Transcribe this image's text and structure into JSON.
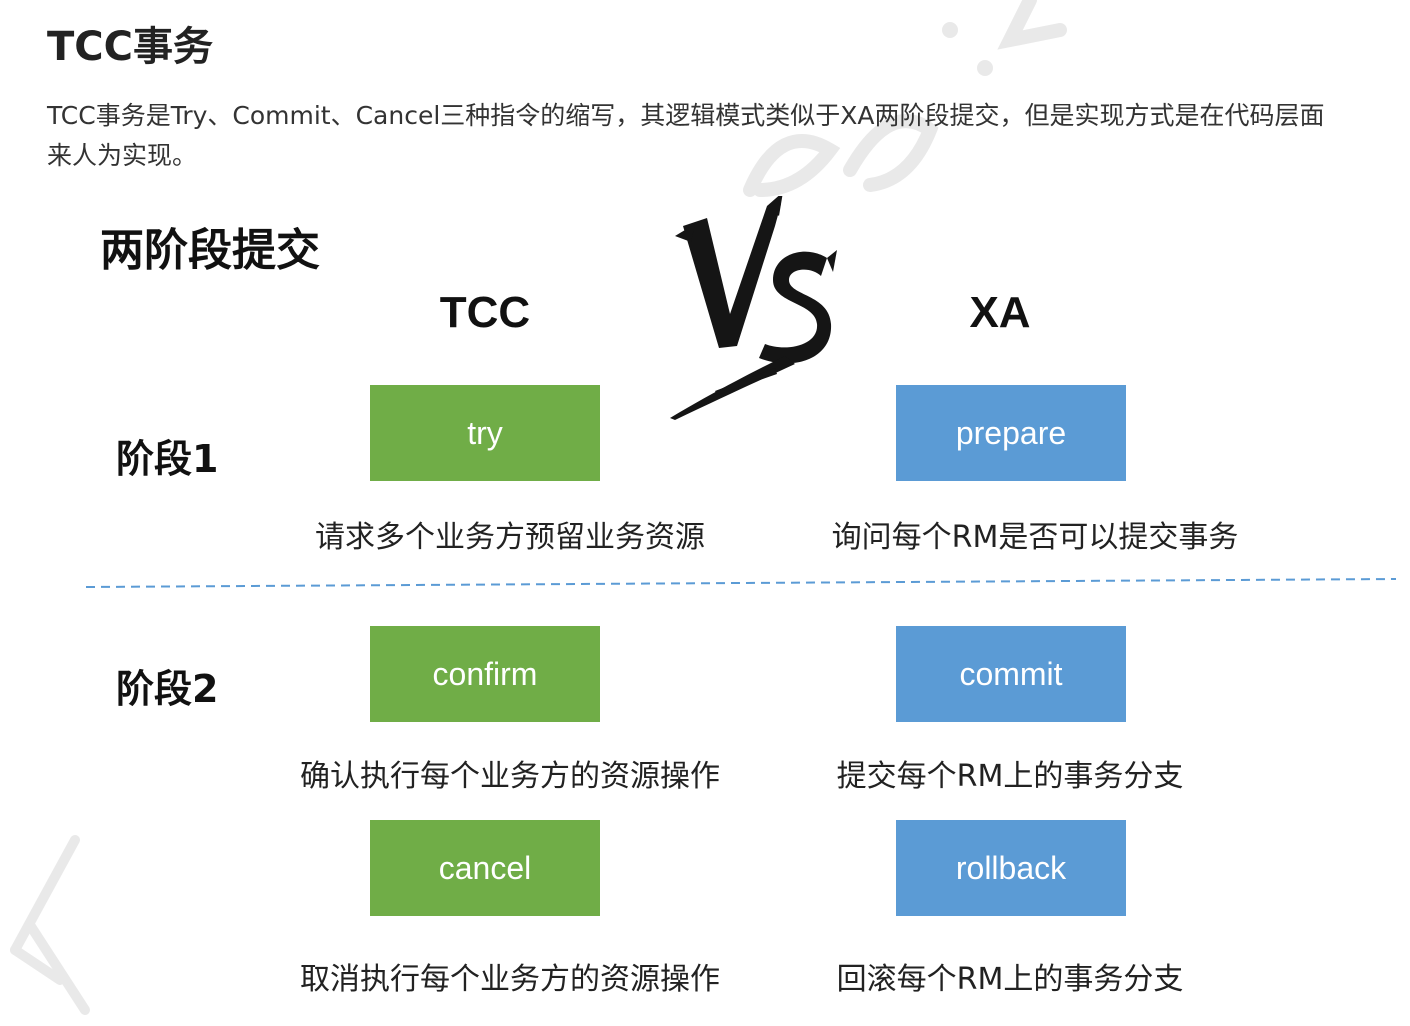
{
  "heading": "TCC事务",
  "paragraph": {
    "line1": "TCC事务是Try、Commit、Cancel三种指令的缩写，其逻辑模式类似于XA两阶段提交，但是实现方式是在代码层面",
    "line2": "来人为实现。"
  },
  "diagram": {
    "title": "两阶段提交",
    "columns": {
      "left": "TCC",
      "right": "XA"
    },
    "phases": [
      {
        "label": "阶段1",
        "rows": [
          {
            "tcc_box": "try",
            "tcc_desc": "请求多个业务方预留业务资源",
            "xa_box": "prepare",
            "xa_desc": "询问每个RM是否可以提交事务"
          }
        ]
      },
      {
        "label": "阶段2",
        "rows": [
          {
            "tcc_box": "confirm",
            "tcc_desc": "确认执行每个业务方的资源操作",
            "xa_box": "commit",
            "xa_desc": "提交每个RM上的事务分支"
          },
          {
            "tcc_box": "cancel",
            "tcc_desc": "取消执行每个业务方的资源操作",
            "xa_box": "rollback",
            "xa_desc": "回滚每个RM上的事务分支"
          }
        ]
      }
    ],
    "colors": {
      "tcc": "#70ad47",
      "xa": "#5b9bd5",
      "divider": "#5b9bd5"
    }
  }
}
